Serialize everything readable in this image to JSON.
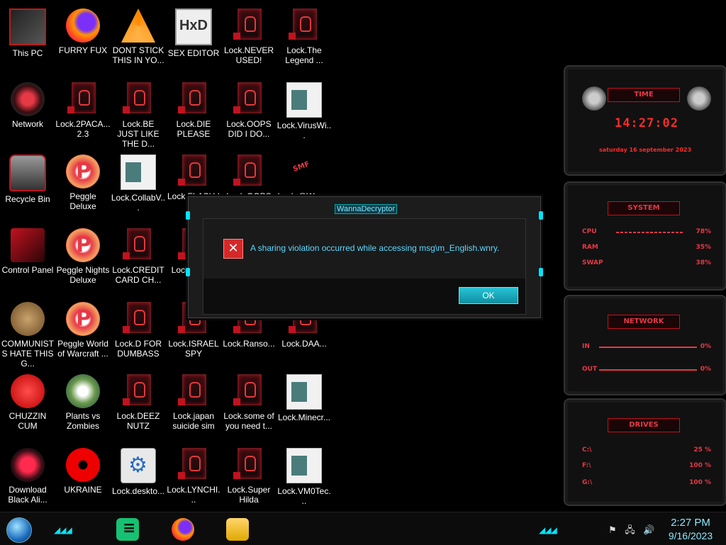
{
  "desktop_icons": [
    {
      "label": "This PC",
      "icon": "pc-icon",
      "kind": "pc"
    },
    {
      "label": "FURRY FUX",
      "icon": "firefox-icon",
      "kind": "firefox"
    },
    {
      "label": "DONT STICK THIS IN YO...",
      "icon": "vlc-icon",
      "kind": "vlc"
    },
    {
      "label": "SEX EDITOR",
      "icon": "hxd-icon",
      "kind": "hxd",
      "text": "HxD"
    },
    {
      "label": "Lock.NEVER USED!",
      "icon": "lock-file-icon",
      "kind": "lock"
    },
    {
      "label": "Lock.The Legend ...",
      "icon": "lock-file-icon",
      "kind": "lock"
    },
    {
      "label": "Network",
      "icon": "network-icon",
      "kind": "net"
    },
    {
      "label": "Lock.2PACA... 2.3",
      "icon": "lock-file-icon",
      "kind": "lock"
    },
    {
      "label": "Lock.BE JUST LIKE THE D...",
      "icon": "lock-file-icon",
      "kind": "lock"
    },
    {
      "label": "Lock.DIE PLEASE",
      "icon": "lock-file-icon",
      "kind": "lock"
    },
    {
      "label": "Lock.OOPS DID I DO...",
      "icon": "lock-file-icon",
      "kind": "lock"
    },
    {
      "label": "Lock.VirusWi...",
      "icon": "webpage-icon",
      "kind": "web"
    },
    {
      "label": "Recycle Bin",
      "icon": "recycle-bin-icon",
      "kind": "bin"
    },
    {
      "label": "Peggle Deluxe",
      "icon": "peggle-icon",
      "kind": "peggle"
    },
    {
      "label": "Lock.CollabV...",
      "icon": "webpage-icon",
      "kind": "web"
    },
    {
      "label": "Lock.FLASH !",
      "icon": "lock-file-icon",
      "kind": "lock"
    },
    {
      "label": "Lock.OOPS",
      "icon": "lock-file-icon",
      "kind": "lock"
    },
    {
      "label": "Lock.@Wana...",
      "icon": "smf-icon",
      "kind": "smf"
    },
    {
      "label": "Control Panel",
      "icon": "control-panel-icon",
      "kind": "cpanel"
    },
    {
      "label": "Peggle Nights Deluxe",
      "icon": "peggle-icon",
      "kind": "peggle"
    },
    {
      "label": "Lock.CREDIT CARD CH...",
      "icon": "lock-file-icon",
      "kind": "lock"
    },
    {
      "label": "Lock.l... ON",
      "icon": "lock-file-icon",
      "kind": "lock"
    },
    {
      "label": "COMMUNISTS HATE THIS G...",
      "icon": "money-bag-icon",
      "kind": "money"
    },
    {
      "label": "Peggle World of Warcraft ...",
      "icon": "peggle-icon",
      "kind": "peggle"
    },
    {
      "label": "Lock.D FOR DUMBASS",
      "icon": "lock-file-icon",
      "kind": "lock"
    },
    {
      "label": "Lock.ISRAEL SPY",
      "icon": "lock-file-icon",
      "kind": "lock"
    },
    {
      "label": "Lock.Ranso...",
      "icon": "lock-file-icon",
      "kind": "lock"
    },
    {
      "label": "Lock.DAA...",
      "icon": "lock-file-icon",
      "kind": "lock"
    },
    {
      "label": "CHUZZIN CUM",
      "icon": "chuzzle-icon",
      "kind": "chuzz"
    },
    {
      "label": "Plants vs Zombies",
      "icon": "plants-icon",
      "kind": "plants"
    },
    {
      "label": "Lock.DEEZ NUTZ",
      "icon": "lock-file-icon",
      "kind": "lock"
    },
    {
      "label": "Lock.japan suicide sim",
      "icon": "lock-file-icon",
      "kind": "lock"
    },
    {
      "label": "Lock.some of you need t...",
      "icon": "lock-file-icon",
      "kind": "lock"
    },
    {
      "label": "Lock.Minecr...",
      "icon": "webpage-icon",
      "kind": "web"
    },
    {
      "label": "Download Black Ali...",
      "icon": "alien-icon",
      "kind": "dlb"
    },
    {
      "label": "UKRAINE",
      "icon": "radiation-icon",
      "kind": "ukraine"
    },
    {
      "label": "Lock.deskto...",
      "icon": "settings-file-icon",
      "kind": "gear"
    },
    {
      "label": "Lock.LYNCHI...",
      "icon": "lock-file-icon",
      "kind": "lock"
    },
    {
      "label": "Lock.Super Hilda",
      "icon": "lock-file-icon",
      "kind": "lock"
    },
    {
      "label": "Lock.VM0Tec...",
      "icon": "webpage-icon",
      "kind": "web"
    }
  ],
  "dialog": {
    "title": "WannaDecryptor",
    "message": "A sharing violation occurred while accessing msg\\m_English.wnry.",
    "ok_label": "OK",
    "error_icon": "error-x-icon"
  },
  "widgets": {
    "time": {
      "header": "TIME",
      "clock": "14:27:02",
      "date": "saturday 16 september 2023"
    },
    "system": {
      "header": "SYSTEM",
      "rows": [
        {
          "label": "CPU",
          "value": "78%"
        },
        {
          "label": "RAM",
          "value": "35%"
        },
        {
          "label": "SWAP",
          "value": "38%"
        }
      ]
    },
    "network": {
      "header": "NETWORK",
      "rows": [
        {
          "label": "IN",
          "value": "0%"
        },
        {
          "label": "OUT",
          "value": "0%"
        }
      ]
    },
    "drives": {
      "header": "DRIVES",
      "rows": [
        {
          "label": "C:\\",
          "value": "25 %"
        },
        {
          "label": "F:\\",
          "value": "100 %"
        },
        {
          "label": "G:\\",
          "value": "100 %"
        }
      ]
    }
  },
  "taskbar": {
    "time": "2:27 PM",
    "date": "9/16/2023",
    "tray_icons": [
      "flag-icon",
      "network-tray-icon",
      "volume-icon"
    ]
  },
  "colors": {
    "accent_cyan": "#00e5ff",
    "alert_red": "#e63946",
    "ok_button": "#1fb6c8"
  }
}
